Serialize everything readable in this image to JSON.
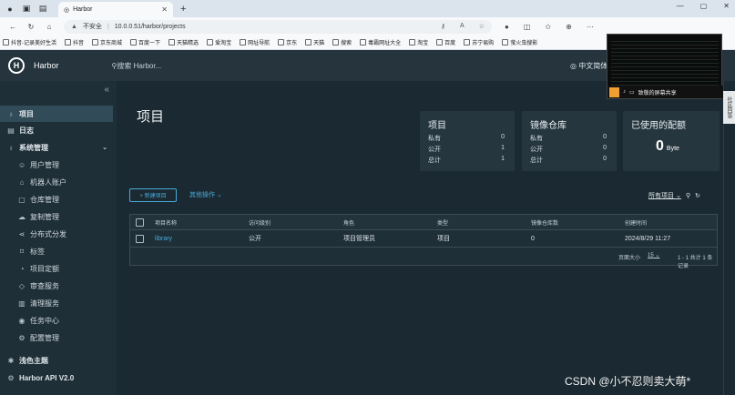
{
  "browser": {
    "tab_title": "Harbor",
    "new_tab": "+",
    "insecure": "不安全",
    "url": "10.0.0.51/harbor/projects",
    "bookmarks": [
      "抖音-记录美好生活",
      "抖音",
      "京东商城",
      "百度一下",
      "天猫精选",
      "爱淘宝",
      "网址导航",
      "京东",
      "天猫",
      "搜索",
      "毒霸网址大全",
      "淘宝",
      "百度",
      "苏宁易购",
      "萤火虫搜影"
    ]
  },
  "header": {
    "logo": "H",
    "brand": "Harbor",
    "search_placeholder": "搜索 Harbor...",
    "language": "中文简体"
  },
  "sidebar": {
    "collapse": "«",
    "items": [
      {
        "label": "项目",
        "icon": "项"
      },
      {
        "label": "日志",
        "icon": "▤"
      },
      {
        "label": "系统管理",
        "icon": "⚙"
      },
      {
        "label": "用户管理",
        "icon": "☺"
      },
      {
        "label": "机器人账户",
        "icon": "⌂"
      },
      {
        "label": "仓库管理",
        "icon": "▢"
      },
      {
        "label": "复制管理",
        "icon": "☁"
      },
      {
        "label": "分布式分发",
        "icon": "⋖"
      },
      {
        "label": "标签",
        "icon": "⌑"
      },
      {
        "label": "项目定额",
        "icon": "◔"
      },
      {
        "label": "审查服务",
        "icon": "◇"
      },
      {
        "label": "清理服务",
        "icon": "▥"
      },
      {
        "label": "任务中心",
        "icon": "◉"
      },
      {
        "label": "配置管理",
        "icon": "⚙"
      },
      {
        "label": "浅色主题",
        "icon": "✱"
      },
      {
        "label": "Harbor API V2.0",
        "icon": "⚙"
      }
    ]
  },
  "main": {
    "title": "项目",
    "cards": {
      "projects": {
        "title": "项目",
        "private_label": "私有",
        "private": "0",
        "public_label": "公开",
        "public": "1",
        "total_label": "总计",
        "total": "1"
      },
      "repos": {
        "title": "镜像仓库",
        "private_label": "私有",
        "private": "0",
        "public_label": "公开",
        "public": "0",
        "total_label": "总计",
        "total": "0"
      },
      "quota": {
        "title": "已使用的配额",
        "value": "0",
        "unit": "Byte"
      }
    },
    "new_project": "+ 新建项目",
    "other_ops": "其他操作 ⌄",
    "filter": "所有项目 ⌄",
    "table": {
      "headers": [
        "项目名称",
        "访问级别",
        "角色",
        "类型",
        "镜像仓库数",
        "创建时间"
      ],
      "rows": [
        [
          "library",
          "公开",
          "项目管理员",
          "项目",
          "0",
          "2024/8/29 11:27"
        ]
      ],
      "page_size_label": "页面大小",
      "page_size": "15",
      "summary": "1 - 1 共计 1 条记录"
    }
  },
  "popup": {
    "text": "致敬的屏幕共享"
  },
  "side_tab": "社区回答",
  "watermark": "CSDN @小不忍则卖大萌*"
}
